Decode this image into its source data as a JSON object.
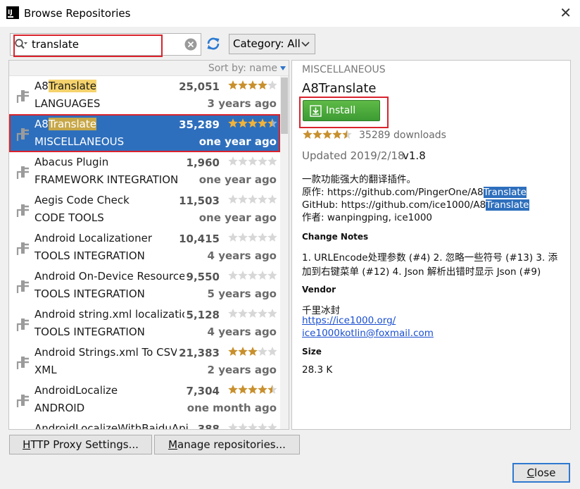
{
  "window": {
    "title": "Browse Repositories",
    "app_icon_text": "IJ"
  },
  "search": {
    "value": "translate",
    "placeholder": ""
  },
  "category": {
    "label": "Category: All"
  },
  "sort": {
    "label": "Sort by: name"
  },
  "plugins": [
    {
      "name_prefix": "A8",
      "name_highlight": "Translate",
      "name_suffix": "",
      "category": "LANGUAGES",
      "downloads": "25,051",
      "rating": 4,
      "date": "3 years ago",
      "selected": false
    },
    {
      "name_prefix": "A8",
      "name_highlight": "Translate",
      "name_suffix": "",
      "category": "MISCELLANEOUS",
      "downloads": "35,289",
      "rating": 4.5,
      "date": "one year ago",
      "selected": true
    },
    {
      "name_prefix": "Abacus Plugin",
      "name_highlight": "",
      "name_suffix": "",
      "category": "FRAMEWORK INTEGRATION",
      "downloads": "1,960",
      "rating": 0,
      "date": "one year ago",
      "selected": false
    },
    {
      "name_prefix": "Aegis Code Check",
      "name_highlight": "",
      "name_suffix": "",
      "category": "CODE TOOLS",
      "downloads": "11,503",
      "rating": 0,
      "date": "one year ago",
      "selected": false
    },
    {
      "name_prefix": "Android Localizationer",
      "name_highlight": "",
      "name_suffix": "",
      "category": "TOOLS INTEGRATION",
      "downloads": "10,415",
      "rating": 0,
      "date": "4 years ago",
      "selected": false
    },
    {
      "name_prefix": "Android On-Device Resource Editor",
      "name_highlight": "",
      "name_suffix": "",
      "category": "TOOLS INTEGRATION",
      "downloads": "9,550",
      "rating": 0,
      "date": "5 years ago",
      "selected": false
    },
    {
      "name_prefix": "Android string.xml localization",
      "name_highlight": "",
      "name_suffix": "",
      "category": "TOOLS INTEGRATION",
      "downloads": "5,128",
      "rating": 0,
      "date": "4 years ago",
      "selected": false
    },
    {
      "name_prefix": "Android Strings.xml To CSV Converter",
      "name_highlight": "",
      "name_suffix": "",
      "category": "XML",
      "downloads": "21,383",
      "rating": 3,
      "date": "2 years ago",
      "selected": false
    },
    {
      "name_prefix": "AndroidLocalize",
      "name_highlight": "",
      "name_suffix": "",
      "category": "ANDROID",
      "downloads": "7,304",
      "rating": 4.5,
      "date": "one month ago",
      "selected": false
    },
    {
      "name_prefix": "AndroidLocalizeWithBaiduApi",
      "name_highlight": "",
      "name_suffix": "",
      "category": "",
      "downloads": "388",
      "rating": 0,
      "date": "",
      "selected": false
    }
  ],
  "detail": {
    "category": "MISCELLANEOUS",
    "name": "A8Translate",
    "install_label": "Install",
    "rating": 4.5,
    "downloads": "35289 downloads",
    "updated": "Updated 2019/2/18",
    "version": "v1.8",
    "desc_line1": "一款功能强大的翻译插件。",
    "desc_line2_prefix": "原作: https://github.com/PingerOne/A8",
    "desc_line2_hl": "Translate",
    "desc_line3_prefix": "GitHub: https://github.com/ice1000/A8",
    "desc_line3_hl": "Translate",
    "desc_line4": "作者: wanpingping, ice1000",
    "change_notes_title": "Change Notes",
    "change_notes": "1. URLEncode处理参数 (#4) 2. 忽略一些符号 (#13) 3. 添加到右键菜单 (#12) 4. Json 解析出错时显示 Json (#9)",
    "vendor_title": "Vendor",
    "vendor_name": "千里冰封",
    "vendor_url": "https://ice1000.org/",
    "vendor_email": "ice1000kotlin@foxmail.com",
    "size_title": "Size",
    "size": "28.3 K"
  },
  "buttons": {
    "proxy_mn": "H",
    "proxy_rest": "TTP Proxy Settings...",
    "manage_mn": "M",
    "manage_rest": "anage repositories...",
    "close_mn": "C",
    "close_rest": "lose"
  },
  "colors": {
    "selection": "#2e6fbd",
    "highlight": "#f5d36c",
    "install_green": "#4caf3e",
    "star": "#c8902d",
    "link": "#1a4fd1"
  }
}
